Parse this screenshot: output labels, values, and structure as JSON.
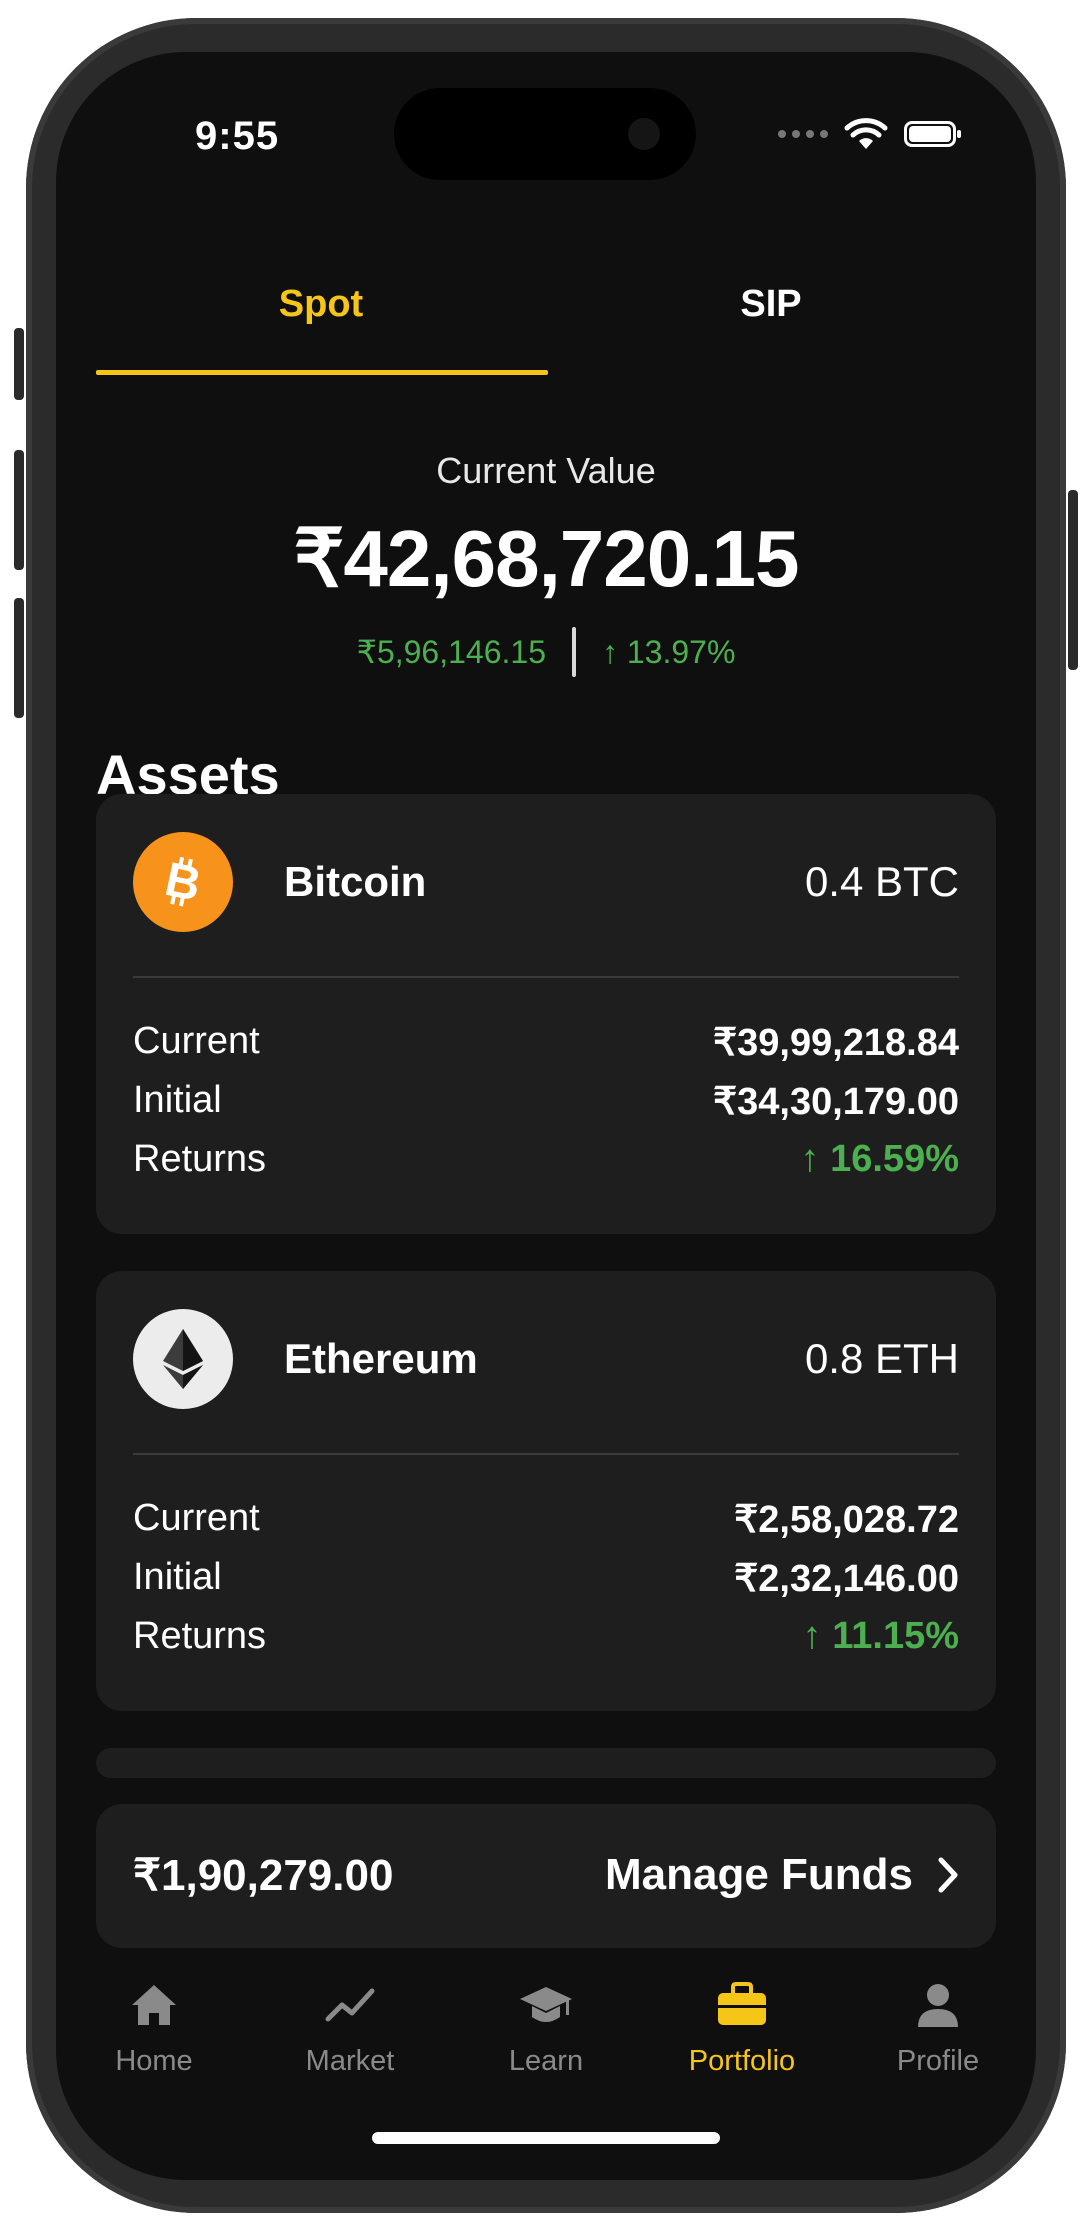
{
  "status_bar": {
    "time": "9:55"
  },
  "tabs": [
    {
      "label": "Spot",
      "active": true
    },
    {
      "label": "SIP",
      "active": false
    }
  ],
  "summary": {
    "label": "Current Value",
    "value": "₹42,68,720.15",
    "gain_amount": "₹5,96,146.15",
    "gain_percent": "↑ 13.97%"
  },
  "assets_title": "Assets",
  "assets": [
    {
      "name": "Bitcoin",
      "quantity": "0.4 BTC",
      "icon": "bitcoin-icon",
      "icon_color": "#f7931a",
      "rows": [
        {
          "label": "Current",
          "value": "₹39,99,218.84"
        },
        {
          "label": "Initial",
          "value": "₹34,30,179.00"
        },
        {
          "label": "Returns",
          "value": "↑ 16.59%"
        }
      ]
    },
    {
      "name": "Ethereum",
      "quantity": "0.8 ETH",
      "icon": "ethereum-icon",
      "icon_color": "#ececec",
      "rows": [
        {
          "label": "Current",
          "value": "₹2,58,028.72"
        },
        {
          "label": "Initial",
          "value": "₹2,32,146.00"
        },
        {
          "label": "Returns",
          "value": "↑ 11.15%"
        }
      ]
    }
  ],
  "funds": {
    "amount": "₹1,90,279.00",
    "action_label": "Manage Funds",
    "icon": "chevron-right-icon"
  },
  "nav": [
    {
      "label": "Home",
      "icon": "home-icon",
      "active": false
    },
    {
      "label": "Market",
      "icon": "trend-line-icon",
      "active": false
    },
    {
      "label": "Learn",
      "icon": "graduation-cap-icon",
      "active": false
    },
    {
      "label": "Portfolio",
      "icon": "briefcase-icon",
      "active": true
    },
    {
      "label": "Profile",
      "icon": "person-icon",
      "active": false
    }
  ],
  "colors": {
    "accent": "#f5c518",
    "positive": "#4caf50",
    "background": "#0f0f0f",
    "card": "#1e1e1e"
  }
}
